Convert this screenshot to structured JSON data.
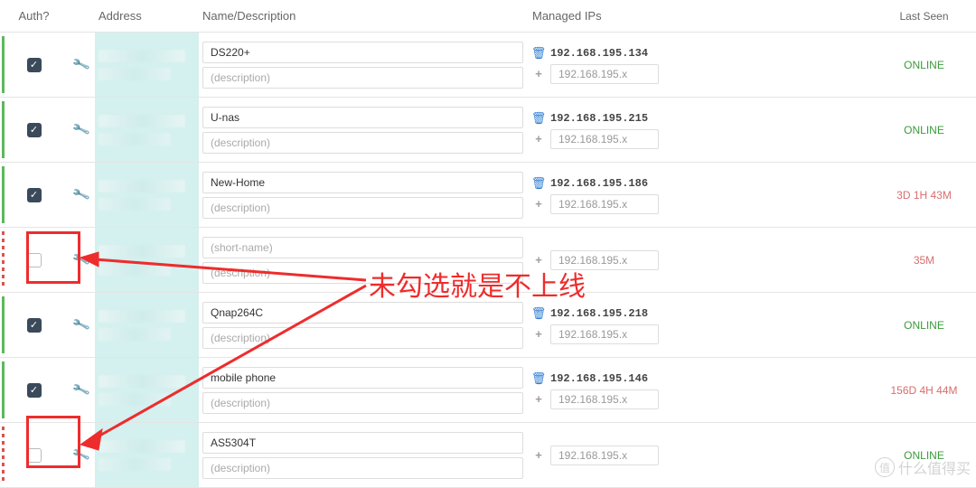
{
  "headers": {
    "auth": "Auth?",
    "address": "Address",
    "name": "Name/Description",
    "ips": "Managed IPs",
    "last": "Last Seen"
  },
  "placeholders": {
    "short_name": "(short-name)",
    "description": "(description)",
    "ip": "192.168.195.x"
  },
  "rows": [
    {
      "auth": true,
      "name": "DS220+",
      "desc": "",
      "ip": "192.168.195.134",
      "last": "ONLINE",
      "last_class": "online"
    },
    {
      "auth": true,
      "name": "U-nas",
      "desc": "",
      "ip": "192.168.195.215",
      "last": "ONLINE",
      "last_class": "online"
    },
    {
      "auth": true,
      "name": "New-Home",
      "desc": "",
      "ip": "192.168.195.186",
      "last": "3D 1H 43M",
      "last_class": "stale"
    },
    {
      "auth": false,
      "name": "",
      "desc": "",
      "ip": "",
      "last": "35M",
      "last_class": "stale"
    },
    {
      "auth": true,
      "name": "Qnap264C",
      "desc": "",
      "ip": "192.168.195.218",
      "last": "ONLINE",
      "last_class": "online"
    },
    {
      "auth": true,
      "name": "mobile phone",
      "desc": "",
      "ip": "192.168.195.146",
      "last": "156D 4H 44M",
      "last_class": "stale"
    },
    {
      "auth": false,
      "name": "AS5304T",
      "desc": "",
      "ip": "",
      "last": "ONLINE",
      "last_class": "online"
    }
  ],
  "annotation": {
    "text": "未勾选就是不上线"
  },
  "watermark": {
    "glyph": "值",
    "text": "什么值得买"
  }
}
